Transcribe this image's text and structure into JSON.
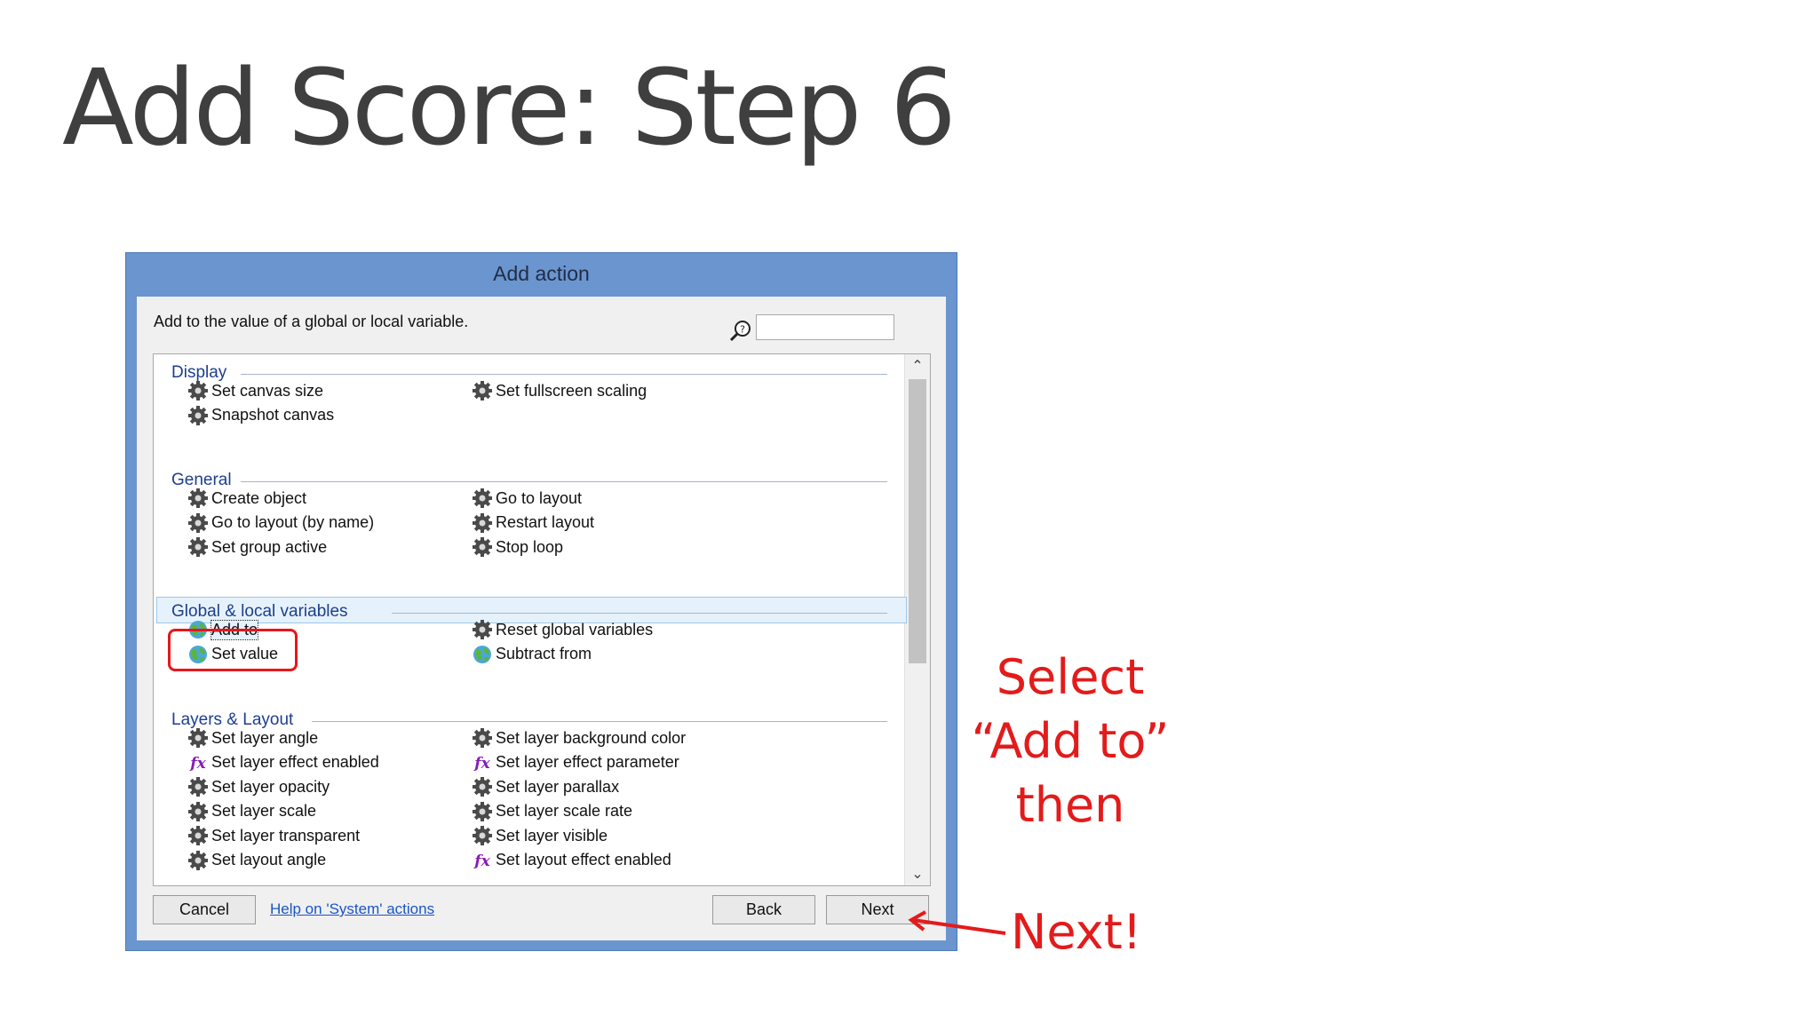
{
  "slide": {
    "title": "Add Score: Step 6"
  },
  "dialog": {
    "title": "Add action",
    "description": "Add to the value of a global or local variable.",
    "search": {
      "placeholder": "",
      "value": ""
    },
    "groups": [
      {
        "name": "Display",
        "left_items": [
          {
            "label": "Set canvas size",
            "icon": "gear-icon"
          },
          {
            "label": "Snapshot canvas",
            "icon": "gear-icon"
          }
        ],
        "right_items": [
          {
            "label": "Set fullscreen scaling",
            "icon": "gear-icon"
          }
        ]
      },
      {
        "name": "General",
        "left_items": [
          {
            "label": "Create object",
            "icon": "gear-icon"
          },
          {
            "label": "Go to layout (by name)",
            "icon": "gear-icon"
          },
          {
            "label": "Set group active",
            "icon": "gear-icon"
          }
        ],
        "right_items": [
          {
            "label": "Go to layout",
            "icon": "gear-icon"
          },
          {
            "label": "Restart layout",
            "icon": "gear-icon"
          },
          {
            "label": "Stop loop",
            "icon": "gear-icon"
          }
        ]
      },
      {
        "name": "Global & local variables",
        "left_items": [
          {
            "label": "Add to",
            "icon": "globe-icon"
          },
          {
            "label": "Set value",
            "icon": "globe-icon"
          }
        ],
        "right_items": [
          {
            "label": "Reset global variables",
            "icon": "gear-icon"
          },
          {
            "label": "Subtract from",
            "icon": "globe-icon"
          }
        ]
      },
      {
        "name": "Layers & Layout",
        "left_items": [
          {
            "label": "Set layer angle",
            "icon": "gear-icon"
          },
          {
            "label": "Set layer effect enabled",
            "icon": "fx-icon"
          },
          {
            "label": "Set layer opacity",
            "icon": "gear-icon"
          },
          {
            "label": "Set layer scale",
            "icon": "gear-icon"
          },
          {
            "label": "Set layer transparent",
            "icon": "gear-icon"
          },
          {
            "label": "Set layout angle",
            "icon": "gear-icon"
          }
        ],
        "right_items": [
          {
            "label": "Set layer background color",
            "icon": "gear-icon"
          },
          {
            "label": "Set layer effect parameter",
            "icon": "fx-icon"
          },
          {
            "label": "Set layer parallax",
            "icon": "gear-icon"
          },
          {
            "label": "Set layer scale rate",
            "icon": "gear-icon"
          },
          {
            "label": "Set layer visible",
            "icon": "gear-icon"
          },
          {
            "label": "Set layout effect enabled",
            "icon": "fx-icon"
          }
        ]
      }
    ],
    "buttons": {
      "cancel": "Cancel",
      "help": "Help on 'System' actions",
      "back": "Back",
      "next": "Next"
    }
  },
  "annotations": {
    "select_line1": "Select",
    "select_line2": "“Add to”",
    "select_line3": "then",
    "next": "Next!",
    "color": "#e31b1b"
  }
}
